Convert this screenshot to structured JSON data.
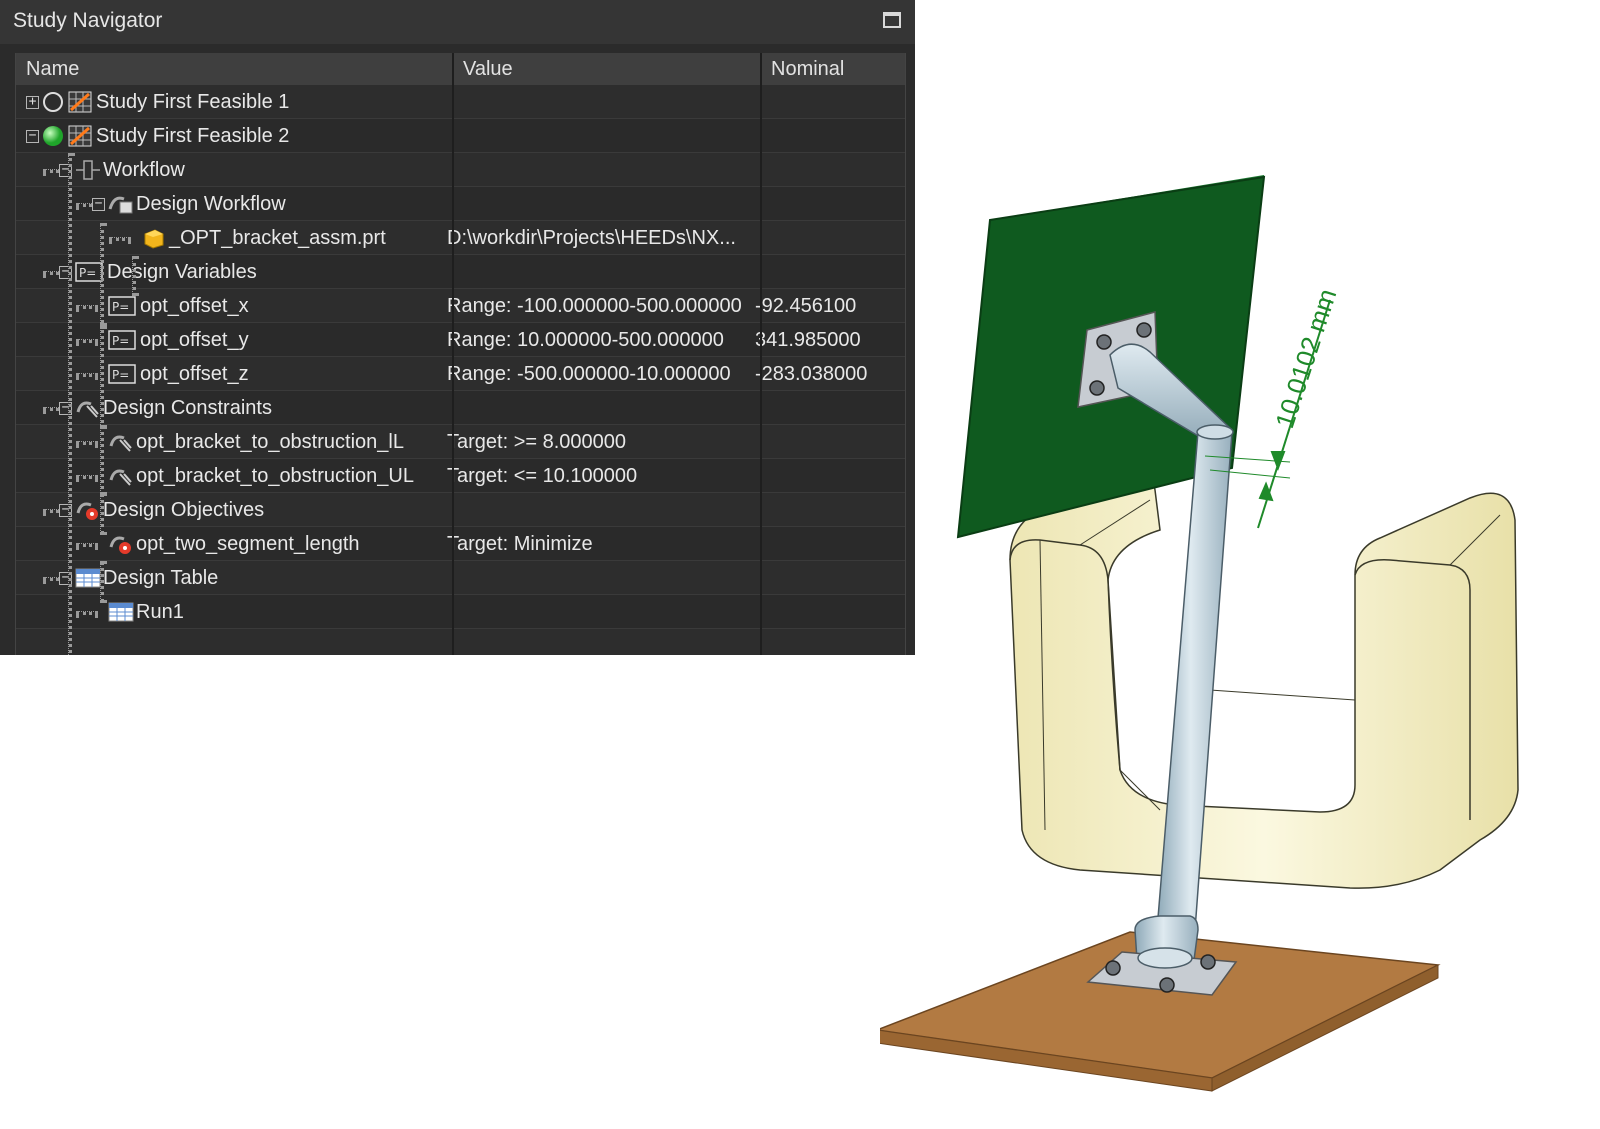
{
  "navigator": {
    "title": "Study Navigator",
    "columns": {
      "name": "Name",
      "value": "Value",
      "nominal": "Nominal"
    },
    "rows": [
      {
        "name": "Study  First Feasible 1",
        "value": "",
        "nominal": ""
      },
      {
        "name": "Study First Feasible 2",
        "value": "",
        "nominal": ""
      },
      {
        "name": "Workflow",
        "value": "",
        "nominal": ""
      },
      {
        "name": "Design Workflow",
        "value": "",
        "nominal": ""
      },
      {
        "name": "_OPT_bracket_assm.prt",
        "value": "D:\\workdir\\Projects\\HEEDs\\NX...",
        "nominal": ""
      },
      {
        "name": "Design Variables",
        "value": "",
        "nominal": ""
      },
      {
        "name": "opt_offset_x",
        "value": "Range: -100.000000-500.000000",
        "nominal": "-92.456100"
      },
      {
        "name": "opt_offset_y",
        "value": "Range: 10.000000-500.000000",
        "nominal": "341.985000"
      },
      {
        "name": "opt_offset_z",
        "value": "Range: -500.000000-10.000000",
        "nominal": "-283.038000"
      },
      {
        "name": "Design Constraints",
        "value": "",
        "nominal": ""
      },
      {
        "name": "opt_bracket_to_obstruction_lL",
        "value": "Target:  >= 8.000000",
        "nominal": ""
      },
      {
        "name": "opt_bracket_to_obstruction_UL",
        "value": "Target:  <= 10.100000",
        "nominal": ""
      },
      {
        "name": "Design Objectives",
        "value": "",
        "nominal": ""
      },
      {
        "name": "opt_two_segment_length",
        "value": "Target: Minimize",
        "nominal": ""
      },
      {
        "name": "Design Table",
        "value": "",
        "nominal": ""
      },
      {
        "name": "Run1",
        "value": "",
        "nominal": ""
      }
    ]
  },
  "model": {
    "dimension_label": "10.0102 mm",
    "colors": {
      "panel": "#0f5a1f",
      "obstruction": "#f3f0c8",
      "tube": "#b9cdd8",
      "base": "#b07840",
      "dimension": "#1f8a2a"
    }
  }
}
